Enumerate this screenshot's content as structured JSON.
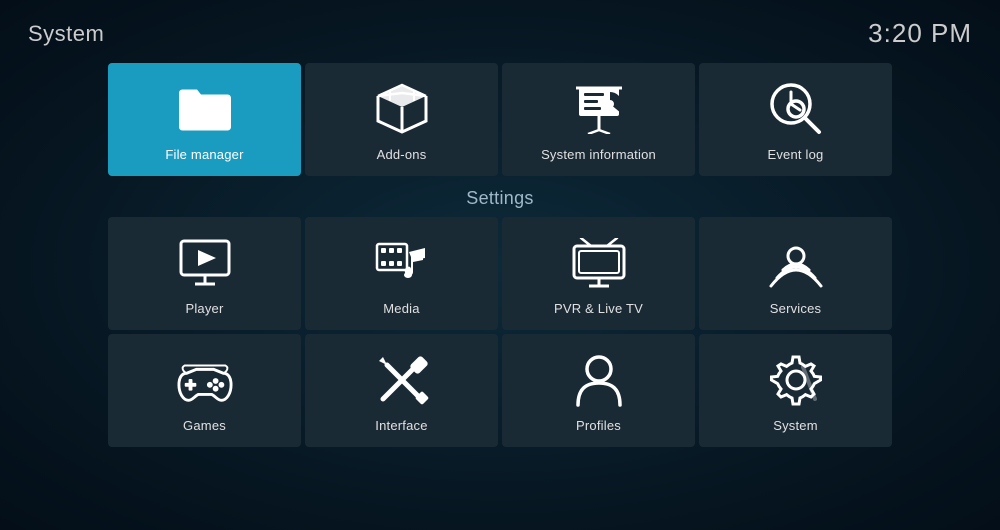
{
  "header": {
    "title": "System",
    "time": "3:20 PM"
  },
  "topRow": {
    "tiles": [
      {
        "id": "file-manager",
        "label": "File manager",
        "icon": "folder",
        "active": true
      },
      {
        "id": "add-ons",
        "label": "Add-ons",
        "icon": "box",
        "active": false
      },
      {
        "id": "system-information",
        "label": "System information",
        "icon": "presentation",
        "active": false
      },
      {
        "id": "event-log",
        "label": "Event log",
        "icon": "clock-search",
        "active": false
      }
    ]
  },
  "settings": {
    "title": "Settings",
    "rows": [
      [
        {
          "id": "player",
          "label": "Player",
          "icon": "monitor-play"
        },
        {
          "id": "media",
          "label": "Media",
          "icon": "media"
        },
        {
          "id": "pvr-live-tv",
          "label": "PVR & Live TV",
          "icon": "tv"
        },
        {
          "id": "services",
          "label": "Services",
          "icon": "podcast"
        }
      ],
      [
        {
          "id": "games",
          "label": "Games",
          "icon": "gamepad"
        },
        {
          "id": "interface",
          "label": "Interface",
          "icon": "paintbrush"
        },
        {
          "id": "profiles",
          "label": "Profiles",
          "icon": "user"
        },
        {
          "id": "system",
          "label": "System",
          "icon": "gear-wrench"
        }
      ]
    ]
  }
}
